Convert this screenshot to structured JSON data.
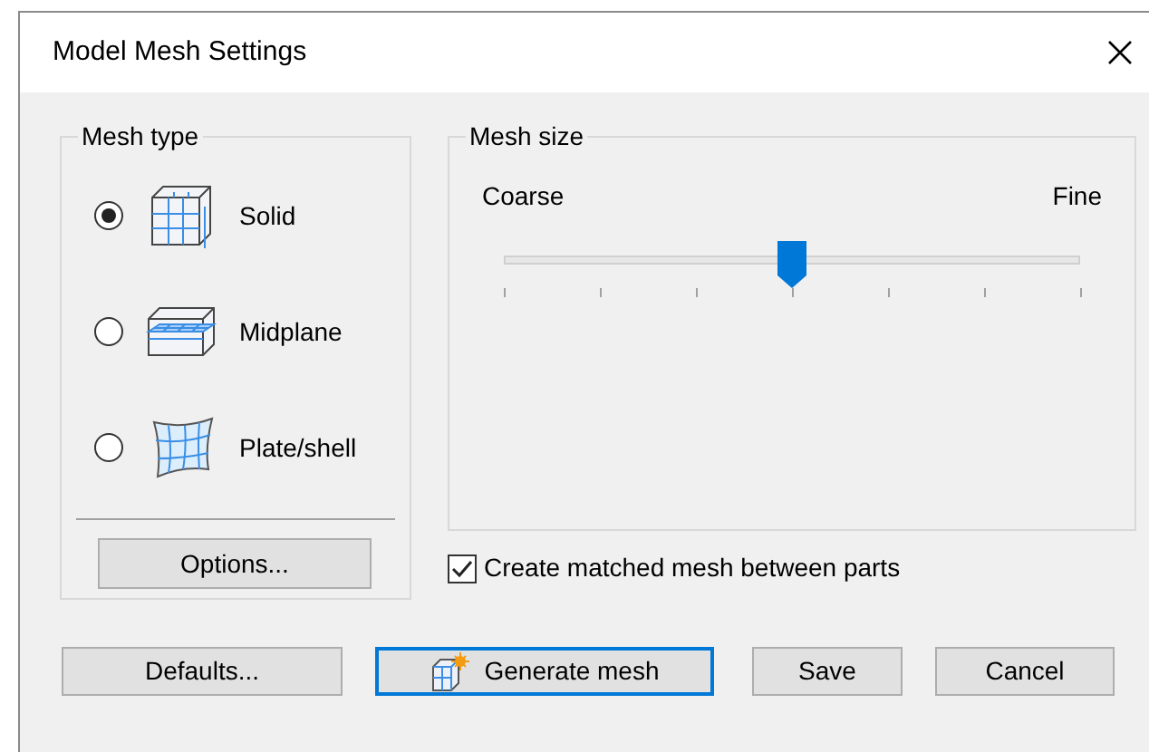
{
  "window": {
    "title": "Model Mesh Settings"
  },
  "mesh_type": {
    "label": "Mesh type",
    "options": [
      {
        "label": "Solid",
        "kind": "solid",
        "selected": true
      },
      {
        "label": "Midplane",
        "kind": "midplane",
        "selected": false
      },
      {
        "label": "Plate/shell",
        "kind": "shell",
        "selected": false
      }
    ],
    "button": "Options..."
  },
  "mesh_size": {
    "label": "Mesh size",
    "min_label": "Coarse",
    "max_label": "Fine",
    "level": 0.5
  },
  "matched_mesh": {
    "label": "Create matched mesh between parts",
    "checked": true
  },
  "buttons": [
    {
      "label": "Defaults...",
      "kind": "plain",
      "focused": false
    },
    {
      "label": "Generate mesh",
      "kind": "generate",
      "focused": true
    },
    {
      "label": "Save",
      "kind": "plain",
      "focused": false
    },
    {
      "label": "Cancel",
      "kind": "plain",
      "focused": false
    }
  ]
}
